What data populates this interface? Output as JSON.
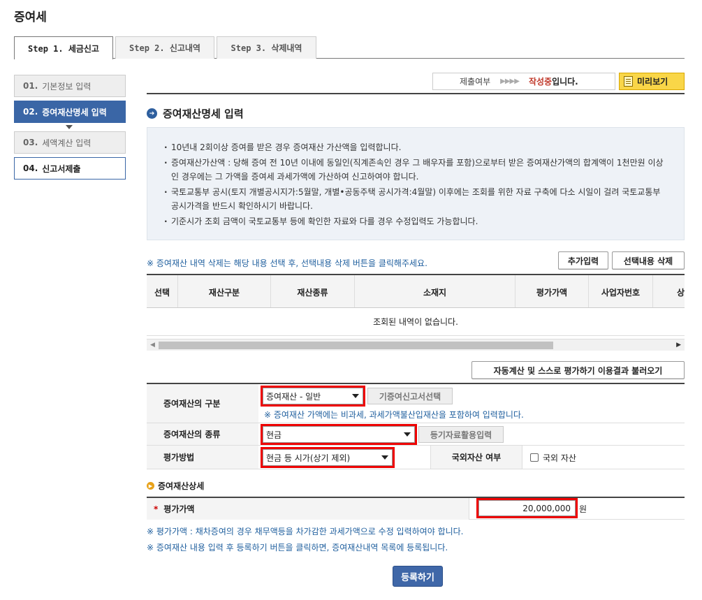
{
  "page": {
    "title": "증여세"
  },
  "tabs": [
    {
      "label": "Step 1. 세금신고"
    },
    {
      "label": "Step 2. 신고내역"
    },
    {
      "label": "Step 3. 삭제내역"
    }
  ],
  "sidebar": {
    "steps": [
      {
        "num": "01.",
        "label": "기본정보 입력"
      },
      {
        "num": "02.",
        "label": "증여재산명세 입력"
      },
      {
        "num": "03.",
        "label": "세액계산 입력"
      },
      {
        "num": "04.",
        "label": "신고서제출"
      }
    ]
  },
  "status": {
    "label": "제출여부",
    "arrows": "▶▶▶▶",
    "value_highlight": "작성중",
    "value_suffix": "입니다.",
    "preview_button": "미리보기"
  },
  "section": {
    "title": "증여재산명세 입력"
  },
  "info": [
    "10년내 2회이상 증여를 받은 경우 증여재산 가산액을 입력합니다.",
    "증여재산가산액 : 당해 증여 전 10년 이내에 동일인(직계존속인 경우 그 배우자를 포함)으로부터 받은 증여재산가액의 합계액이 1천만원 이상인 경우에는 그 가액을 증여세 과세가액에 가산하여 신고하여야 합니다.",
    "국토교통부 공시(토지 개별공시지가:5월말, 개별•공동주택 공시가격:4월말) 이후에는 조회를 위한 자료 구축에 다소 시일이 걸려 국토교통부 공시가격을 반드시 확인하시기 바랍니다.",
    "기준시가 조회 금액이 국토교통부 등에 확인한 자료와 다를 경우 수정입력도 가능합니다."
  ],
  "list": {
    "note": "※ 증여재산 내역 삭제는 해당 내용 선택 후, 선택내용 삭제 버튼을  클릭해주세요.",
    "add_button": "추가입력",
    "delete_button": "선택내용 삭제",
    "columns": [
      "선택",
      "재산구분",
      "재산종류",
      "소재지",
      "평가가액",
      "사업자번호",
      "상호"
    ],
    "empty_text": "조회된 내역이 없습니다."
  },
  "load_button": "자동계산 및 스스로 평가하기 이용결과 불러오기",
  "form": {
    "category": {
      "label": "증여재산의 구분",
      "value": "증여재산 - 일반",
      "button": "기증여신고서선택",
      "note": "※ 증여재산 가액에는 비과세, 과세가액불산입재산을 포함하여 입력합니다."
    },
    "type": {
      "label": "증여재산의 종류",
      "value": "현금",
      "button": "등기자료활용입력"
    },
    "method": {
      "label": "평가방법",
      "value": "현금 등 시가(상기 제외)"
    },
    "foreign": {
      "label": "국외자산 여부",
      "checkbox_label": "국외 자산"
    }
  },
  "detail": {
    "title": "증여재산상세",
    "star": "*",
    "amount_label": "평가가액",
    "amount_value": "20,000,000",
    "unit": "원"
  },
  "notes_bottom": [
    "※ 평가가액 : 채차증여의 경우 채무액등을 차가감한 과세가액으로 수정 입력하여야 합니다.",
    "※ 증여재산 내용 입력 후 등록하기 버튼을 클릭하면, 증여재산내역 목록에 등록됩니다."
  ],
  "submit_button": "등록하기",
  "colors": {
    "accent": "#3a66a6",
    "highlight_box": "#e00000",
    "preview_yellow": "#f9d648"
  }
}
